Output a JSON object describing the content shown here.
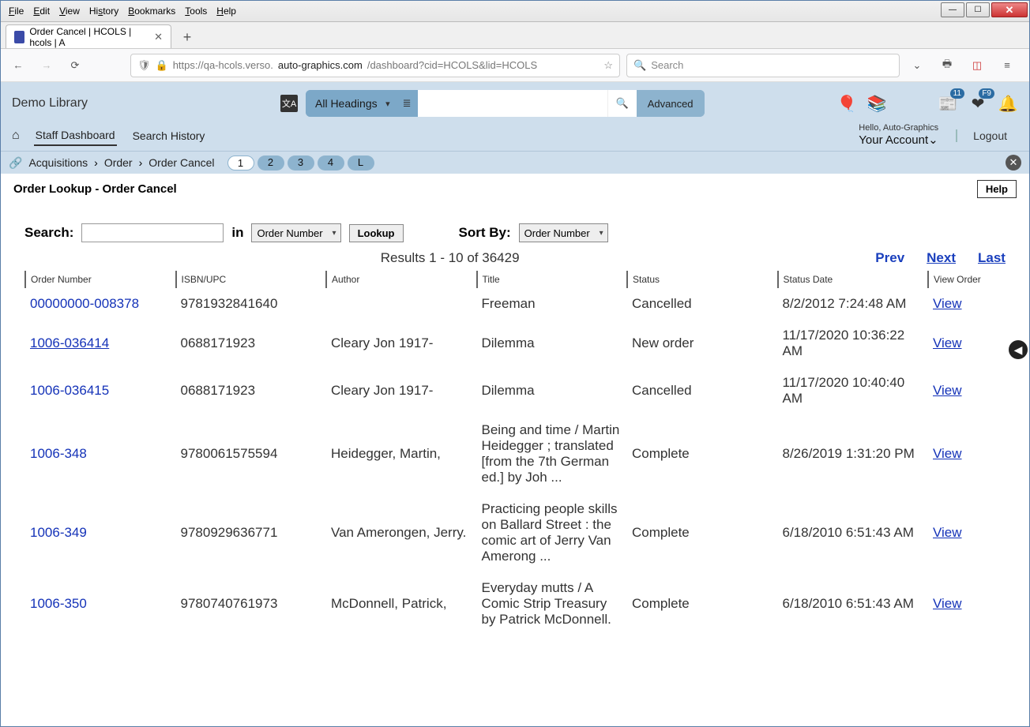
{
  "browser": {
    "menus": [
      "File",
      "Edit",
      "View",
      "History",
      "Bookmarks",
      "Tools",
      "Help"
    ],
    "tab_title": "Order Cancel | HCOLS | hcols | A",
    "url_prefix": "https://qa-hcols.verso.",
    "url_domain": "auto-graphics.com",
    "url_path": "/dashboard?cid=HCOLS&lid=HCOLS",
    "search_placeholder": "Search"
  },
  "header": {
    "library": "Demo Library",
    "headings_label": "All Headings",
    "advanced": "Advanced",
    "badge_count": "11",
    "fav_badge": "F9",
    "hello": "Hello, Auto-Graphics",
    "account": "Your Account",
    "logout": "Logout",
    "nav": {
      "staff": "Staff Dashboard",
      "history": "Search History"
    }
  },
  "breadcrumb": {
    "items": [
      "Acquisitions",
      "Order",
      "Order Cancel"
    ],
    "pills": [
      "1",
      "2",
      "3",
      "4",
      "L"
    ]
  },
  "page": {
    "title": "Order Lookup - Order Cancel",
    "help": "Help",
    "search_label": "Search:",
    "in_label": "in",
    "in_select": "Order Number",
    "lookup": "Lookup",
    "sortby_label": "Sort By:",
    "sortby_select": "Order Number",
    "results": "Results 1 - 10 of 36429",
    "pager": {
      "prev": "Prev",
      "next": "Next",
      "last": "Last"
    },
    "columns": [
      "Order Number",
      "ISBN/UPC",
      "Author",
      "Title",
      "Status",
      "Status Date",
      "View Order"
    ],
    "view_label": "View",
    "rows": [
      {
        "order": "00000000-008378",
        "isbn": "9781932841640",
        "author": "",
        "title": "Freeman",
        "status": "Cancelled",
        "date": "8/2/2012 7:24:48 AM",
        "underline": false
      },
      {
        "order": "1006-036414",
        "isbn": "0688171923",
        "author": "Cleary Jon 1917-",
        "title": "Dilemma",
        "status": "New order",
        "date": "11/17/2020 10:36:22 AM",
        "underline": true
      },
      {
        "order": "1006-036415",
        "isbn": "0688171923",
        "author": "Cleary Jon 1917-",
        "title": "Dilemma",
        "status": "Cancelled",
        "date": "11/17/2020 10:40:40 AM",
        "underline": false
      },
      {
        "order": "1006-348",
        "isbn": "9780061575594",
        "author": "Heidegger, Martin,",
        "title": "Being and time / Martin Heidegger ; translated [from the 7th German ed.] by Joh ...",
        "status": "Complete",
        "date": "8/26/2019 1:31:20 PM",
        "underline": false
      },
      {
        "order": "1006-349",
        "isbn": "9780929636771",
        "author": "Van Amerongen, Jerry.",
        "title": "Practicing people skills on Ballard Street : the comic art of Jerry Van Amerong ...",
        "status": "Complete",
        "date": "6/18/2010 6:51:43 AM",
        "underline": false
      },
      {
        "order": "1006-350",
        "isbn": "9780740761973",
        "author": "McDonnell, Patrick,",
        "title": "Everyday mutts / A Comic Strip Treasury by Patrick McDonnell.",
        "status": "Complete",
        "date": "6/18/2010 6:51:43 AM",
        "underline": false
      }
    ]
  }
}
